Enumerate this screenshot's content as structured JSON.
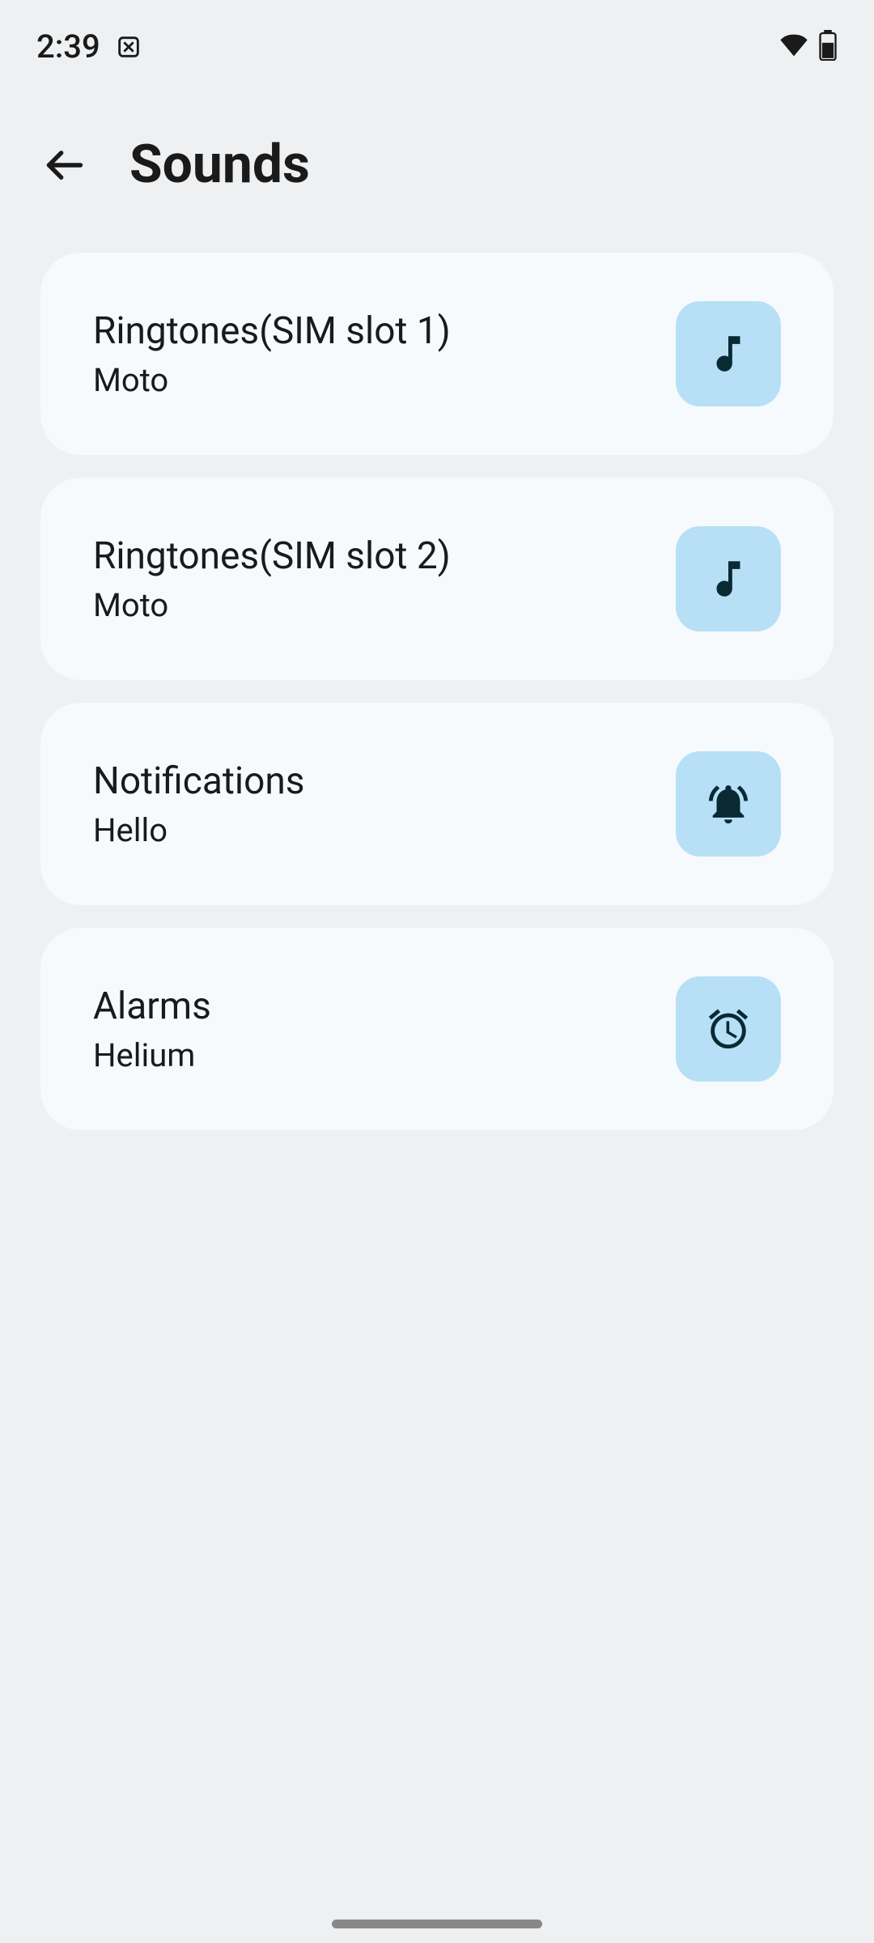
{
  "status": {
    "time": "2:39"
  },
  "header": {
    "title": "Sounds"
  },
  "cards": [
    {
      "title": "Ringtones(SIM slot 1)",
      "subtitle": "Moto",
      "icon": "music-note-icon"
    },
    {
      "title": "Ringtones(SIM slot 2)",
      "subtitle": "Moto",
      "icon": "music-note-icon"
    },
    {
      "title": "Notifications",
      "subtitle": "Hello",
      "icon": "bell-icon"
    },
    {
      "title": "Alarms",
      "subtitle": "Helium",
      "icon": "alarm-clock-icon"
    }
  ]
}
